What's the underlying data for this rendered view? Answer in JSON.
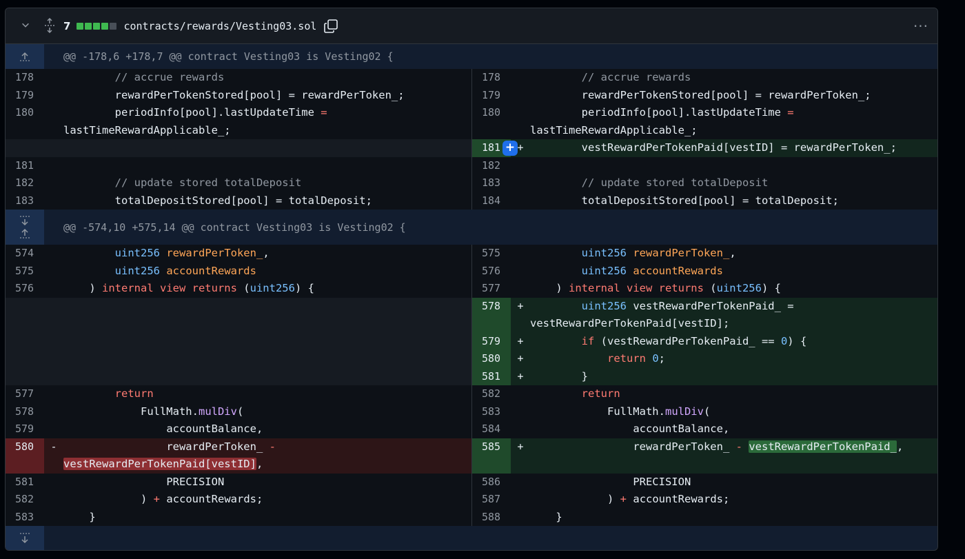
{
  "file": {
    "changes": "7",
    "path": "contracts/rewards/Vesting03.sol"
  },
  "hunks": [
    "@@ -178,6 +178,7 @@ contract Vesting03 is Vesting02 {",
    "@@ -574,10 +575,14 @@ contract Vesting03 is Vesting02 {"
  ],
  "left": {
    "n178": "178",
    "n179": "179",
    "n180": "180",
    "n181": "181",
    "n182": "182",
    "n183": "183",
    "n574": "574",
    "n575": "575",
    "n576": "576",
    "n577": "577",
    "n578": "578",
    "n579": "579",
    "n580": "580",
    "n581": "581",
    "n582": "582",
    "n583": "583"
  },
  "right": {
    "n178": "178",
    "n179": "179",
    "n180": "180",
    "n181": "181",
    "n182": "182",
    "n183": "183",
    "n184": "184",
    "n575": "575",
    "n576": "576",
    "n577": "577",
    "n578": "578",
    "n579": "579",
    "n580": "580",
    "n581": "581",
    "n582": "582",
    "n583": "583",
    "n584": "584",
    "n585": "585",
    "n586": "586",
    "n587": "587",
    "n588": "588"
  },
  "signs": {
    "plus": "+",
    "minus": "-"
  },
  "code": {
    "accrue": "        // accrue rewards",
    "stored": "        rewardPerTokenStored[pool] = rewardPerToken_;",
    "period_a": "        periodInfo[pool].lastUpdateTime",
    "period_eq": " =",
    "period_b": "lastTimeRewardApplicable_;",
    "vest_paid": "        vestRewardPerTokenPaid[vestID] = rewardPerToken_;",
    "update_comment": "        // update stored totalDeposit",
    "total_deposit": "        totalDepositStored[pool] = totalDeposit;",
    "uint_kw": "uint256",
    "reward_param": "rewardPerToken_",
    "account_param": "accountRewards",
    "internal": "internal view returns",
    "uint_ret": "uint256",
    "vest_decl_b": " vestRewardPerTokenPaid_ =",
    "vest_decl_c": "vestRewardPerTokenPaid[vestID];",
    "if_kw": "if",
    "if_rest": " (vestRewardPerTokenPaid_ == ",
    "zero": "0",
    "if_end": ") {",
    "return_kw": "return",
    "close_brace": "}",
    "fullmath": "FullMath.",
    "muldiv": "mulDiv",
    "account_balance": "accountBalance,",
    "reward_minus": "rewardPerToken_",
    "minus_op": "-",
    "vest_old": "vestRewardPerTokenPaid[vestID]",
    "vest_new": "vestRewardPerTokenPaid_",
    "comma": ",",
    "precision": "PRECISION",
    "close_paren": ")",
    "plus_op": "+",
    "account_rewards_end": "accountRewards;"
  },
  "icons": {
    "collapse": "chevron-down-icon",
    "expand": "unfold-icon",
    "copy": "copy-icon",
    "more": "kebab-horizontal-icon",
    "plus": "plus-icon"
  }
}
